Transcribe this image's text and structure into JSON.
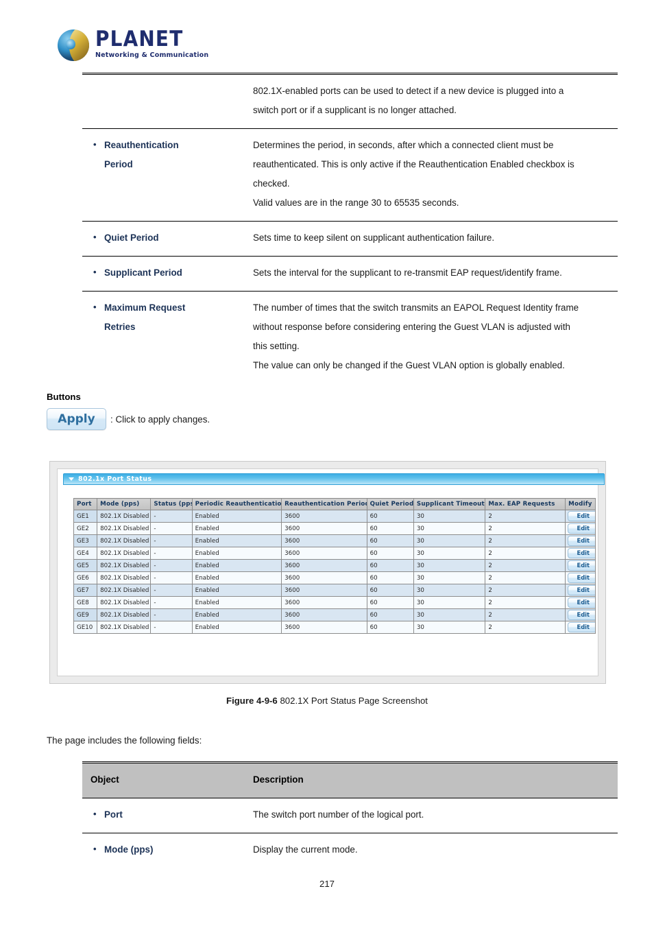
{
  "header": {
    "logo_name": "PLANET",
    "logo_tagline": "Networking & Communication"
  },
  "fields_table_top": {
    "rows": [
      {
        "object": "",
        "object_cont": "",
        "description": [
          "802.1X-enabled ports can be used to detect if a new device is plugged into a",
          "switch port or if a supplicant is no longer attached."
        ]
      },
      {
        "object": "Reauthentication",
        "object_cont": "Period",
        "description": [
          "Determines the period, in seconds, after which a connected client must be",
          "reauthenticated. This is only active if the Reauthentication Enabled checkbox is",
          "checked.",
          "Valid values are in the range 30 to 65535 seconds."
        ]
      },
      {
        "object": "Quiet Period",
        "object_cont": "",
        "description": [
          "Sets time to keep silent on supplicant authentication failure."
        ]
      },
      {
        "object": "Supplicant Period",
        "object_cont": "",
        "description": [
          "Sets the interval for the supplicant to re-transmit EAP request/identify frame."
        ]
      },
      {
        "object": "Maximum Request",
        "object_cont": "Retries",
        "description": [
          "The number of times that the switch transmits an EAPOL Request Identity frame",
          "without response before considering entering the Guest VLAN is adjusted with",
          "this setting.",
          "The value can only be changed if the Guest VLAN option is globally enabled."
        ]
      }
    ]
  },
  "buttons_section": {
    "heading": "Buttons",
    "apply_label": "Apply",
    "apply_caption": ": Click to apply changes."
  },
  "screenshot": {
    "panel_title": "802.1x Port Status",
    "caret_icon": "triangle-down-icon",
    "columns": [
      "Port",
      "Mode (pps)",
      "Status (pps)",
      "Periodic Reauthentication",
      "Reauthentication Period",
      "Quiet Period",
      "Supplicant Timeout",
      "Max. EAP Requests",
      "Modify"
    ],
    "edit_label": "Edit",
    "rows": [
      {
        "port": "GE1",
        "mode": "802.1X Disabled",
        "status": "-",
        "periodic": "Enabled",
        "reauth_period": "3600",
        "quiet_period": "60",
        "supplicant_timeout": "30",
        "max_eap": "2",
        "modify": "Edit"
      },
      {
        "port": "GE2",
        "mode": "802.1X Disabled",
        "status": "-",
        "periodic": "Enabled",
        "reauth_period": "3600",
        "quiet_period": "60",
        "supplicant_timeout": "30",
        "max_eap": "2",
        "modify": "Edit"
      },
      {
        "port": "GE3",
        "mode": "802.1X Disabled",
        "status": "-",
        "periodic": "Enabled",
        "reauth_period": "3600",
        "quiet_period": "60",
        "supplicant_timeout": "30",
        "max_eap": "2",
        "modify": "Edit"
      },
      {
        "port": "GE4",
        "mode": "802.1X Disabled",
        "status": "-",
        "periodic": "Enabled",
        "reauth_period": "3600",
        "quiet_period": "60",
        "supplicant_timeout": "30",
        "max_eap": "2",
        "modify": "Edit"
      },
      {
        "port": "GE5",
        "mode": "802.1X Disabled",
        "status": "-",
        "periodic": "Enabled",
        "reauth_period": "3600",
        "quiet_period": "60",
        "supplicant_timeout": "30",
        "max_eap": "2",
        "modify": "Edit"
      },
      {
        "port": "GE6",
        "mode": "802.1X Disabled",
        "status": "-",
        "periodic": "Enabled",
        "reauth_period": "3600",
        "quiet_period": "60",
        "supplicant_timeout": "30",
        "max_eap": "2",
        "modify": "Edit"
      },
      {
        "port": "GE7",
        "mode": "802.1X Disabled",
        "status": "-",
        "periodic": "Enabled",
        "reauth_period": "3600",
        "quiet_period": "60",
        "supplicant_timeout": "30",
        "max_eap": "2",
        "modify": "Edit"
      },
      {
        "port": "GE8",
        "mode": "802.1X Disabled",
        "status": "-",
        "periodic": "Enabled",
        "reauth_period": "3600",
        "quiet_period": "60",
        "supplicant_timeout": "30",
        "max_eap": "2",
        "modify": "Edit"
      },
      {
        "port": "GE9",
        "mode": "802.1X Disabled",
        "status": "-",
        "periodic": "Enabled",
        "reauth_period": "3600",
        "quiet_period": "60",
        "supplicant_timeout": "30",
        "max_eap": "2",
        "modify": "Edit"
      },
      {
        "port": "GE10",
        "mode": "802.1X Disabled",
        "status": "-",
        "periodic": "Enabled",
        "reauth_period": "3600",
        "quiet_period": "60",
        "supplicant_timeout": "30",
        "max_eap": "2",
        "modify": "Edit"
      }
    ]
  },
  "figure": {
    "number": "Figure 4-9-6",
    "title": "802.1X Port Status Page Screenshot"
  },
  "intro_line": "The page includes the following fields:",
  "fields_table_bottom": {
    "header_object": "Object",
    "header_description": "Description",
    "rows": [
      {
        "object": "Port",
        "description": "The switch port number of the logical port."
      },
      {
        "object": "Mode (pps)",
        "description": "Display the current mode."
      }
    ]
  },
  "footer": {
    "page_number": "217"
  },
  "colors": {
    "brand_navy": "#1f2d6e",
    "object_label": "#1c3256",
    "panel_blue": "#3eaee4",
    "grid_header_gray": "#c2c2c2",
    "row_odd": "#d9e6f2",
    "row_even": "#f7fbfe",
    "edit_text": "#1c5d92",
    "table_header_gray": "#c0c0c0"
  }
}
